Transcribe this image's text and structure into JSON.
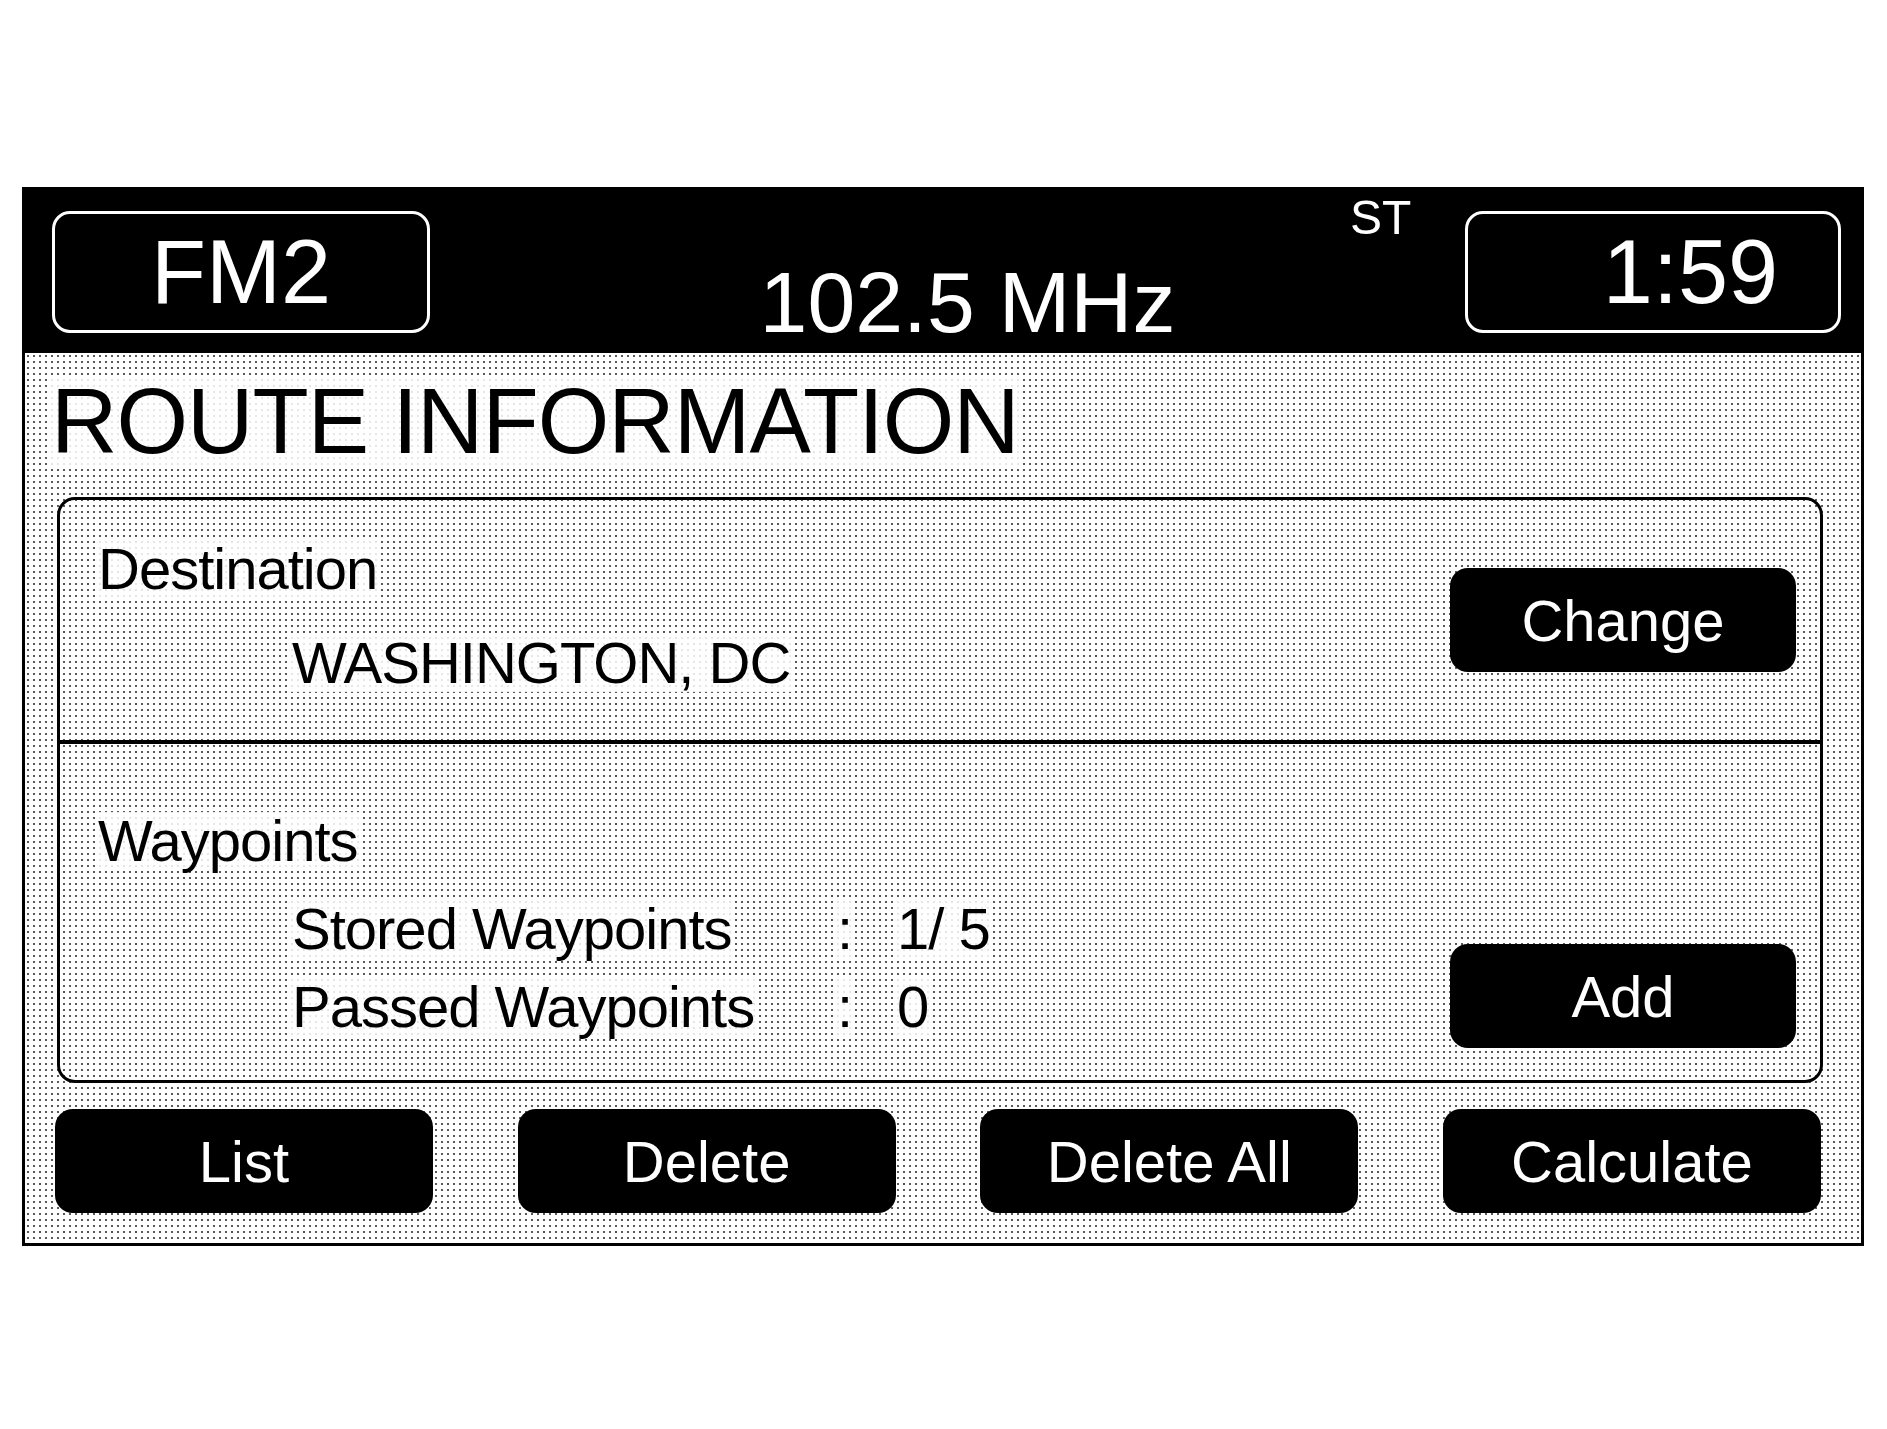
{
  "header": {
    "band": "FM2",
    "frequency": "102.5 MHz",
    "stereo": "ST",
    "clock": "1:59"
  },
  "screen_title": "ROUTE INFORMATION",
  "destination": {
    "label": "Destination",
    "value": "WASHINGTON, DC",
    "button": "Change"
  },
  "waypoints": {
    "label": "Waypoints",
    "rows": [
      {
        "label": "Stored Waypoints",
        "separator": ":",
        "value": "1/ 5"
      },
      {
        "label": "Passed Waypoints",
        "separator": ":",
        "value": "0"
      }
    ],
    "button": "Add"
  },
  "buttons": [
    "List",
    "Delete",
    "Delete All",
    "Calculate"
  ]
}
